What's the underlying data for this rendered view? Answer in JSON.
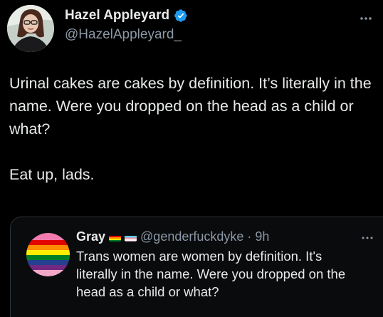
{
  "author": {
    "display_name": "Hazel Appleyard",
    "handle": "@HazelAppleyard_",
    "verified": true
  },
  "tweet": {
    "paragraph_1": "Urinal cakes are cakes by definition. It’s literally in the name. Were you dropped on the head as a child or what?",
    "paragraph_2": "Eat up, lads."
  },
  "quoted_tweet": {
    "display_name": "Gray",
    "handle": "@genderfuckdyke",
    "separator": "·",
    "time": "9h",
    "text": "Trans women are women by definition. It's literally in the name. Were you dropped on the head as a child or what?",
    "name_flags": [
      "rainbow-flag",
      "transgender-flag"
    ]
  },
  "colors": {
    "background": "#000000",
    "text_primary": "#e7e9ea",
    "text_secondary": "#8b98a5",
    "verified_blue": "#1d9bf0",
    "border": "#2f3336"
  },
  "icons": [
    "verified-badge-icon",
    "more-options-icon"
  ]
}
